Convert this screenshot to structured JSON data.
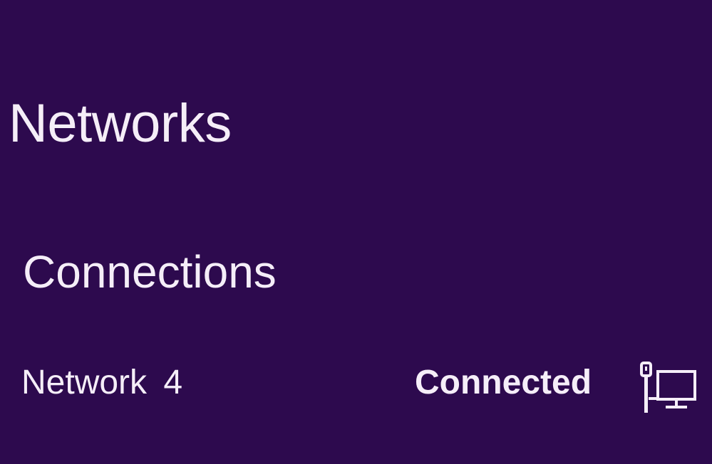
{
  "pane": {
    "title": "Networks",
    "section_header": "Connections",
    "connections": [
      {
        "name": "Network  4",
        "status": "Connected",
        "icon": "wired-network-icon"
      }
    ]
  },
  "colors": {
    "background": "#2d0a4e",
    "text": "#f5eef8"
  }
}
